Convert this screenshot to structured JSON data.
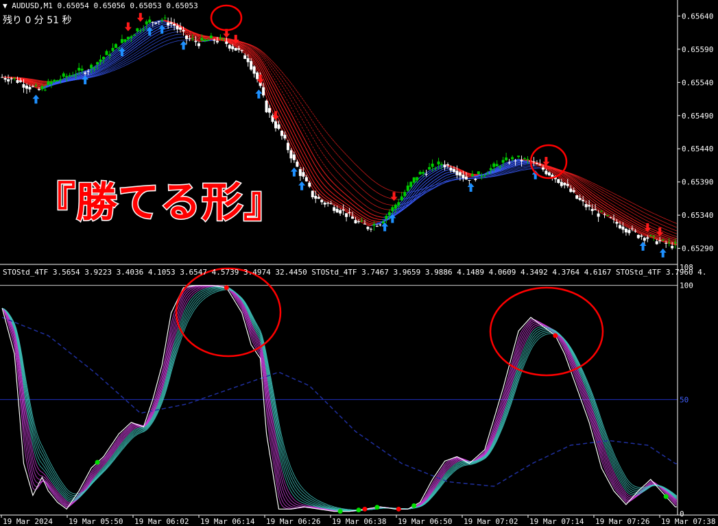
{
  "symbol_line": "▼ AUDUSD,M1  0.65054 0.65056 0.65053 0.65053",
  "countdown": "残り 0 分 51 秒",
  "banner_text": "『勝てる形』",
  "sto_header": "STOStd_4TF 3.5654 3.9223 3.4036 4.1053 3.6547 4.5739 3.4974 32.4450   STOStd_4TF 3.7467 3.9659 3.9886 4.1489 4.0609 4.3492 4.3764 4.6167   STOStd_4TF 3.7960 4.",
  "colors": {
    "background": "#000000",
    "bull_candle": "#00cc00",
    "bear_candle": "#ffffff",
    "ribbon_red": "#ff2020",
    "ribbon_blue": "#3a5cff",
    "arrow_up": "#1e90ff",
    "arrow_down": "#ff1a1a",
    "stoch_main": "#ffffff",
    "stoch_magenta": "#d040e0",
    "stoch_teal": "#40c8c0",
    "stoch_blue": "#2030a0",
    "level_line": "#2030c0",
    "circle": "#ff0000",
    "axis_text": "#ffffff"
  },
  "chart_data": [
    {
      "type": "candlestick",
      "title": "AUDUSD,M1",
      "price_axis_labels": [
        "0.65640",
        "0.65590",
        "0.65540",
        "0.65490",
        "0.65440",
        "0.65390",
        "0.65340",
        "0.65290"
      ],
      "ylim": [
        0.6527,
        0.6566
      ],
      "close_path": [
        [
          0,
          0.65548
        ],
        [
          8,
          0.65545
        ],
        [
          16,
          0.65535
        ],
        [
          24,
          0.65528
        ],
        [
          32,
          0.6554
        ],
        [
          40,
          0.65548
        ],
        [
          48,
          0.65555
        ],
        [
          56,
          0.6556
        ],
        [
          64,
          0.65575
        ],
        [
          72,
          0.6559
        ],
        [
          80,
          0.65605
        ],
        [
          88,
          0.6562
        ],
        [
          96,
          0.65632
        ],
        [
          104,
          0.65635
        ],
        [
          112,
          0.65626
        ],
        [
          120,
          0.65606
        ],
        [
          128,
          0.656
        ],
        [
          136,
          0.65605
        ],
        [
          144,
          0.65602
        ],
        [
          152,
          0.6559
        ],
        [
          160,
          0.65575
        ],
        [
          166,
          0.65545
        ],
        [
          172,
          0.655
        ],
        [
          178,
          0.65475
        ],
        [
          184,
          0.6545
        ],
        [
          190,
          0.6542
        ],
        [
          196,
          0.65395
        ],
        [
          202,
          0.6537
        ],
        [
          208,
          0.6536
        ],
        [
          214,
          0.65355
        ],
        [
          222,
          0.65345
        ],
        [
          230,
          0.6533
        ],
        [
          238,
          0.65322
        ],
        [
          246,
          0.6533
        ],
        [
          254,
          0.6535
        ],
        [
          262,
          0.65375
        ],
        [
          270,
          0.654
        ],
        [
          278,
          0.6541
        ],
        [
          286,
          0.65418
        ],
        [
          294,
          0.6541
        ],
        [
          302,
          0.65395
        ],
        [
          310,
          0.654
        ],
        [
          318,
          0.6541
        ],
        [
          326,
          0.6542
        ],
        [
          334,
          0.65425
        ],
        [
          342,
          0.65422
        ],
        [
          350,
          0.65412
        ],
        [
          358,
          0.654
        ],
        [
          366,
          0.65385
        ],
        [
          374,
          0.65365
        ],
        [
          382,
          0.6535
        ],
        [
          390,
          0.6534
        ],
        [
          398,
          0.6533
        ],
        [
          406,
          0.6532
        ],
        [
          414,
          0.6531
        ],
        [
          422,
          0.65305
        ],
        [
          430,
          0.65298
        ],
        [
          438,
          0.65294
        ]
      ],
      "total_bars": 440,
      "up_arrow_bars": [
        22,
        54,
        78,
        96,
        104,
        118,
        167,
        190,
        195,
        249,
        254,
        305,
        347,
        417,
        430
      ],
      "down_arrow_bars": [
        82,
        90,
        146,
        152,
        168,
        178,
        255,
        354,
        420,
        428
      ],
      "time_labels": [
        "19 Mar 2024",
        "19 Mar 05:50",
        "19 Mar 06:02",
        "19 Mar 06:14",
        "19 Mar 06:26",
        "19 Mar 06:38",
        "19 Mar 06:50",
        "19 Mar 07:02",
        "19 Mar 07:14",
        "19 Mar 07:26",
        "19 Mar 07:38"
      ]
    },
    {
      "type": "line",
      "title": "STOStd_4TF",
      "ylim": [
        0,
        108
      ],
      "axis_labels": [
        "108",
        "100",
        "50",
        "0"
      ],
      "level_line": 50,
      "main_line": [
        [
          0,
          90
        ],
        [
          8,
          70
        ],
        [
          14,
          22
        ],
        [
          20,
          8
        ],
        [
          26,
          16
        ],
        [
          30,
          10
        ],
        [
          36,
          5
        ],
        [
          42,
          2
        ],
        [
          50,
          10
        ],
        [
          58,
          20
        ],
        [
          66,
          25
        ],
        [
          76,
          35
        ],
        [
          84,
          40
        ],
        [
          92,
          38
        ],
        [
          98,
          50
        ],
        [
          104,
          65
        ],
        [
          110,
          88
        ],
        [
          118,
          99
        ],
        [
          126,
          100
        ],
        [
          136,
          100
        ],
        [
          146,
          99
        ],
        [
          156,
          88
        ],
        [
          162,
          74
        ],
        [
          168,
          68
        ],
        [
          172,
          35
        ],
        [
          180,
          2
        ],
        [
          188,
          2
        ],
        [
          196,
          3
        ],
        [
          206,
          2
        ],
        [
          216,
          1
        ],
        [
          226,
          1
        ],
        [
          236,
          2
        ],
        [
          246,
          3
        ],
        [
          256,
          2
        ],
        [
          264,
          2
        ],
        [
          272,
          5
        ],
        [
          280,
          15
        ],
        [
          288,
          23
        ],
        [
          296,
          25
        ],
        [
          304,
          22
        ],
        [
          314,
          28
        ],
        [
          326,
          55
        ],
        [
          336,
          80
        ],
        [
          344,
          86
        ],
        [
          352,
          82
        ],
        [
          360,
          78
        ],
        [
          366,
          70
        ],
        [
          374,
          55
        ],
        [
          382,
          40
        ],
        [
          390,
          20
        ],
        [
          398,
          10
        ],
        [
          406,
          4
        ],
        [
          414,
          10
        ],
        [
          422,
          15
        ],
        [
          430,
          9
        ],
        [
          438,
          3
        ]
      ],
      "signal_line": [
        [
          0,
          86
        ],
        [
          30,
          78
        ],
        [
          60,
          62
        ],
        [
          90,
          44
        ],
        [
          120,
          48
        ],
        [
          150,
          55
        ],
        [
          180,
          62
        ],
        [
          200,
          56
        ],
        [
          230,
          36
        ],
        [
          260,
          22
        ],
        [
          290,
          14
        ],
        [
          320,
          12
        ],
        [
          345,
          22
        ],
        [
          370,
          30
        ],
        [
          395,
          32
        ],
        [
          420,
          30
        ],
        [
          438,
          22
        ]
      ],
      "green_dot_bars": [
        62,
        220,
        232,
        244,
        268,
        432
      ],
      "red_dot_bars": [
        146,
        236,
        258,
        360
      ]
    }
  ]
}
